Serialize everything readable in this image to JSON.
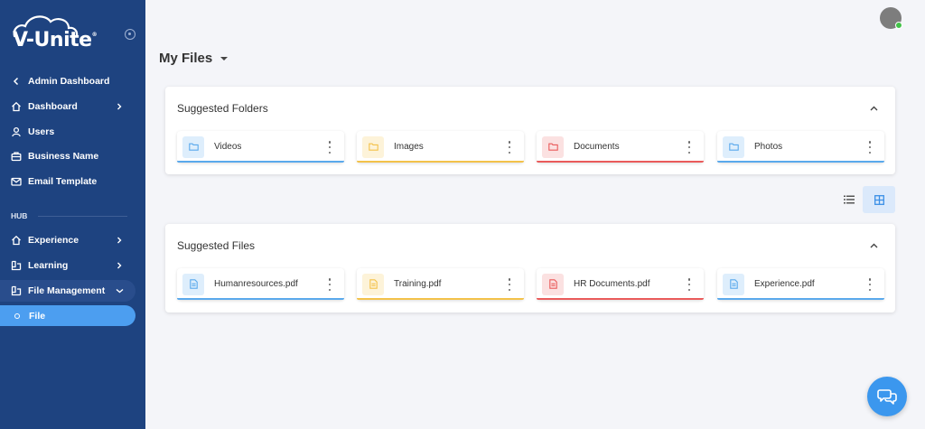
{
  "brand": {
    "name": "V-Unite",
    "mark": "®"
  },
  "sidebar": {
    "back": "Admin Dashboard",
    "items": [
      {
        "label": "Dashboard",
        "icon": "home-icon"
      },
      {
        "label": "Users",
        "icon": "user-icon"
      },
      {
        "label": "Business Name",
        "icon": "briefcase-icon"
      },
      {
        "label": "Email Template",
        "icon": "mail-icon"
      }
    ],
    "hub_label": "HUB",
    "hub_items": [
      {
        "label": "Experience",
        "icon": "home-icon"
      },
      {
        "label": "Learning",
        "icon": "book-icon"
      },
      {
        "label": "File Management",
        "icon": "book-icon"
      }
    ],
    "active_sub": "File"
  },
  "header": {
    "title": "My Files"
  },
  "folders": {
    "title": "Suggested Folders",
    "items": [
      {
        "label": "Videos",
        "color": "#5aa9ec",
        "tint": "#deeefc"
      },
      {
        "label": "Images",
        "color": "#f3c24a",
        "tint": "#fdf3d9"
      },
      {
        "label": "Documents",
        "color": "#ea5b5b",
        "tint": "#fbe1e1"
      },
      {
        "label": "Photos",
        "color": "#5aa9ec",
        "tint": "#deeefc"
      }
    ]
  },
  "files": {
    "title": "Suggested Files",
    "items": [
      {
        "label": "Humanresources.pdf",
        "color": "#5aa9ec",
        "tint": "#deeefc"
      },
      {
        "label": "Training.pdf",
        "color": "#f3c24a",
        "tint": "#fdf3d9"
      },
      {
        "label": "HR Documents.pdf",
        "color": "#ea5b5b",
        "tint": "#fbe1e1"
      },
      {
        "label": "Experience.pdf",
        "color": "#5aa9ec",
        "tint": "#deeefc"
      }
    ]
  },
  "colors": {
    "sidebar": "#1e4380",
    "active": "#4c9ef0",
    "accent": "#3b97ee"
  }
}
